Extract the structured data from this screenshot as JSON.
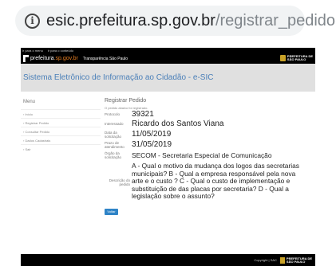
{
  "browser": {
    "url_host": "esic.prefeitura.sp.gov.br",
    "url_path": "/registrar_pedido"
  },
  "top_strip": {
    "link1": "ir para o menu",
    "link2": "ir para o conteúdo"
  },
  "header": {
    "logo_main": "prefeitura",
    "logo_suffix": ".sp.gov.br",
    "link": "Transparência São Paulo",
    "pref_logo_line1": "PREFEITURA DE",
    "pref_logo_line2": "SÃO PAULO"
  },
  "band": {
    "title": "Sistema Eletrônico de Informação ao Cidadão - e-SIC"
  },
  "sidebar": {
    "title": "Menu",
    "items": [
      {
        "label": "› Início"
      },
      {
        "label": "› Registrar Pedido"
      },
      {
        "label": "› Consultar Pedido"
      },
      {
        "label": "› Dados Cadastrais"
      },
      {
        "label": "› Sair"
      }
    ]
  },
  "main": {
    "title": "Registrar Pedido",
    "note": "O pedido abaixo foi registrado.",
    "fields": {
      "protocolo_label": "Protocolo",
      "protocolo": "39321",
      "interessado_label": "Interessado",
      "interessado": "Ricardo dos Santos Viana",
      "data_label": "Data da solicitação",
      "data": "11/05/2019",
      "prazo_label": "Prazo de atendimento",
      "prazo": "31/05/2019",
      "orgao_label": "Órgão da solicitação",
      "orgao": "SECOM - Secretaria Especial de Comunicação",
      "descricao_label": "Descrição do pedido",
      "descricao": "A - Qual o motivo da mudança dos logos das secretarias municipais? B - Qual a empresa responsável pela nova arte e o custo ? C - Qual o custo de implementação e substituição de das placas por secretaria? D - Qual a legislação sobre o assunto?"
    },
    "button": "Voltar"
  },
  "footer": {
    "copyright": "Copyright | SAC",
    "logo_line1": "PREFEITURA DE",
    "logo_line2": "SÃO PAULO"
  }
}
